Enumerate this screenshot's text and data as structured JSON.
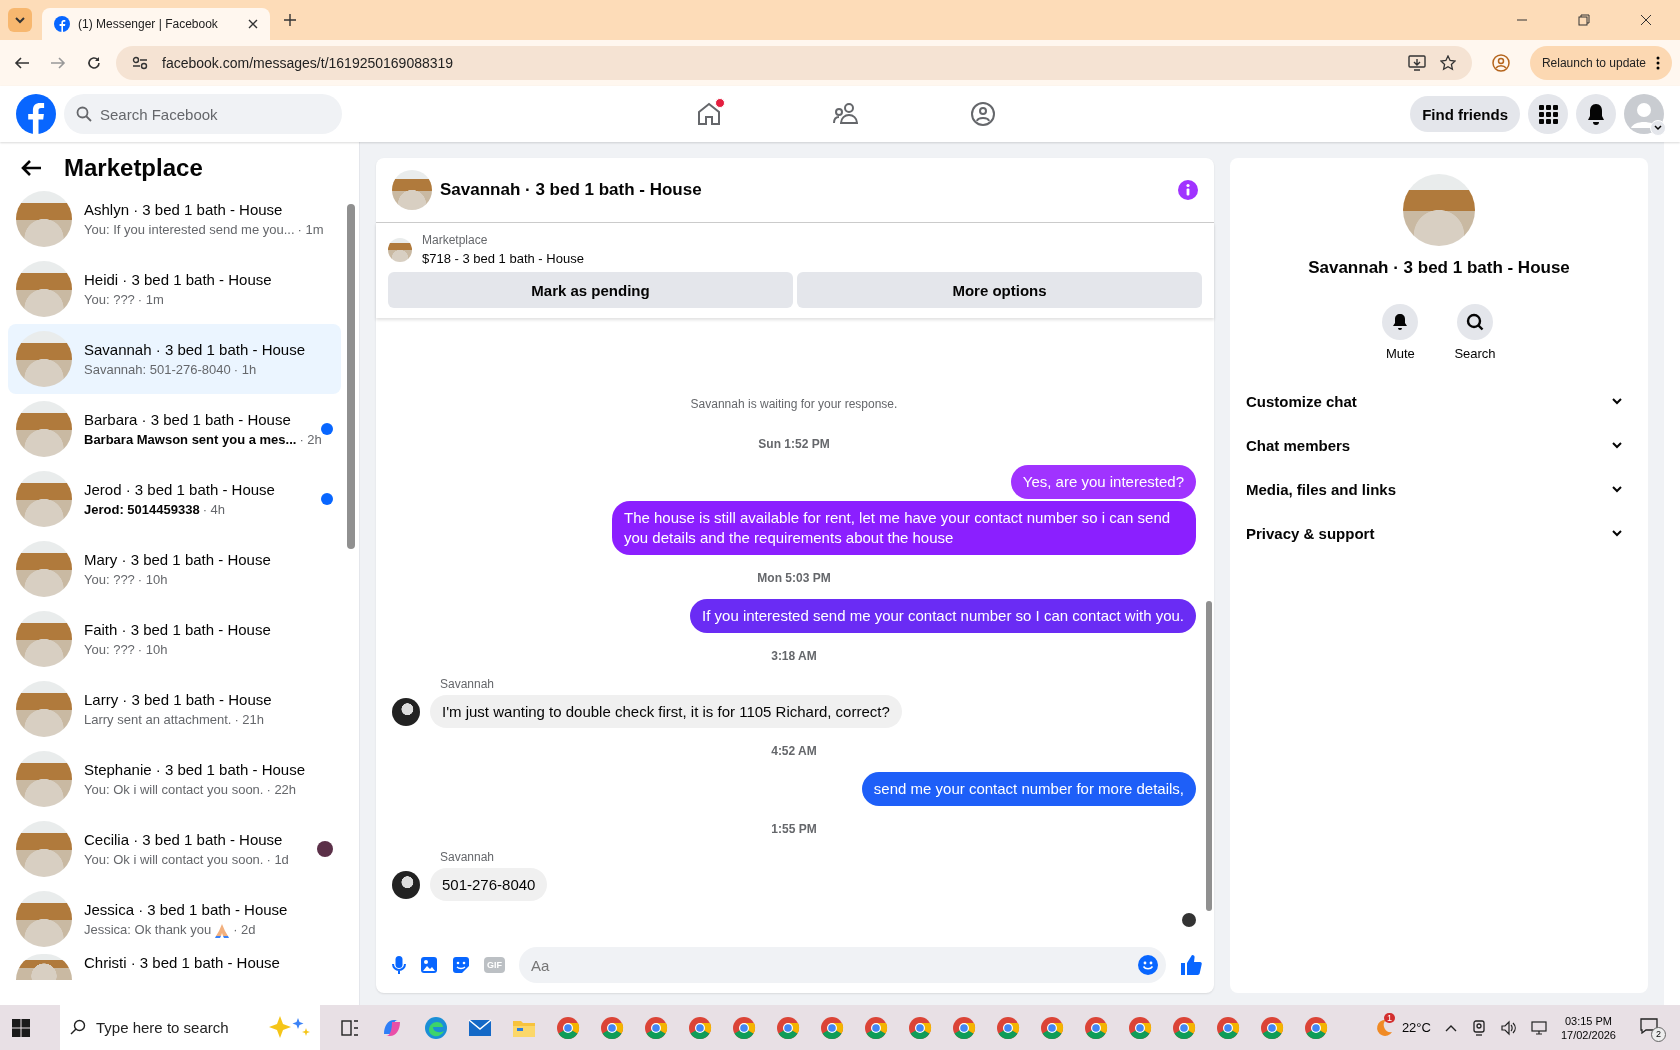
{
  "browser": {
    "tab_title": "(1) Messenger | Facebook",
    "url": "facebook.com/messages/t/1619250169088319",
    "relaunch": "Relaunch to update"
  },
  "header": {
    "search_placeholder": "Search Facebook",
    "nav": [
      {
        "kind": "home",
        "badge": true
      },
      {
        "kind": "friends",
        "badge": false
      },
      {
        "kind": "groups",
        "badge": false
      }
    ],
    "find_friends": "Find friends"
  },
  "sidebar": {
    "title": "Marketplace",
    "conversations": [
      {
        "title": "Ashlyn · 3 bed 1 bath - House",
        "preview": "You: If you interested send me you...",
        "time": "· 1m",
        "selected": false,
        "unread": false,
        "seen": false,
        "emoji": false
      },
      {
        "title": "Heidi · 3 bed 1 bath - House",
        "preview": "You: ???",
        "time": "· 1m",
        "selected": false,
        "unread": false,
        "seen": false,
        "emoji": false
      },
      {
        "title": "Savannah · 3 bed 1 bath - House",
        "preview": "Savannah: 501-276-8040",
        "time": "· 1h",
        "selected": true,
        "unread": false,
        "seen": false,
        "emoji": false
      },
      {
        "title": "Barbara · 3 bed 1 bath - House",
        "preview": "Barbara Mawson sent you a mes...",
        "time": "· 2h",
        "selected": false,
        "unread": true,
        "seen": false,
        "emoji": false
      },
      {
        "title": "Jerod · 3 bed 1 bath - House",
        "preview": "Jerod: 5014459338",
        "time": "· 4h",
        "selected": false,
        "unread": true,
        "seen": false,
        "emoji": false
      },
      {
        "title": "Mary · 3 bed 1 bath - House",
        "preview": "You: ???",
        "time": "· 10h",
        "selected": false,
        "unread": false,
        "seen": false,
        "emoji": false
      },
      {
        "title": "Faith · 3 bed 1 bath - House",
        "preview": "You: ???",
        "time": "· 10h",
        "selected": false,
        "unread": false,
        "seen": false,
        "emoji": false
      },
      {
        "title": "Larry · 3 bed 1 bath - House",
        "preview": "Larry sent an attachment.",
        "time": "· 21h",
        "selected": false,
        "unread": false,
        "seen": false,
        "emoji": false
      },
      {
        "title": "Stephanie · 3 bed 1 bath - House",
        "preview": "You: Ok i will contact you soon.",
        "time": "· 22h",
        "selected": false,
        "unread": false,
        "seen": false,
        "emoji": false
      },
      {
        "title": "Cecilia · 3 bed 1 bath - House",
        "preview": "You: Ok i will contact you soon.",
        "time": "· 1d",
        "selected": false,
        "unread": false,
        "seen": true,
        "emoji": false
      },
      {
        "title": "Jessica · 3 bed 1 bath - House",
        "preview": "Jessica: Ok thank you",
        "time": "· 2d",
        "selected": false,
        "unread": false,
        "seen": false,
        "emoji": true
      },
      {
        "title": "Christi · 3 bed 1 bath - House",
        "selected": false
      }
    ]
  },
  "chat": {
    "title": "Savannah · 3 bed 1 bath - House",
    "listing": {
      "source": "Marketplace",
      "price_title": "$718 - 3 bed 1 bath - House"
    },
    "actions": [
      "Mark as pending",
      "More options"
    ],
    "messages": [
      {
        "kind": "status",
        "text": "Savannah is waiting for your response."
      },
      {
        "kind": "time",
        "text": "Sun 1:52 PM"
      },
      {
        "kind": "sent",
        "text": "Yes, are you interested?",
        "color": "#a033ff"
      },
      {
        "kind": "sent",
        "text": "The house is still available for rent, let me have your contact number so i can send you details and the requirements about the house",
        "color": "#8b1fff"
      },
      {
        "kind": "time",
        "text": "Mon 5:03 PM"
      },
      {
        "kind": "sent",
        "text": "If you interested send me your contact number so I can contact with you.",
        "color": "#6a2cf4"
      },
      {
        "kind": "time",
        "text": "3:18 AM"
      },
      {
        "kind": "received",
        "sender": "Savannah",
        "text": "I'm just wanting to double check first, it is for 1105 Richard, correct?"
      },
      {
        "kind": "time",
        "text": "4:52 AM"
      },
      {
        "kind": "sent",
        "text": "send me your contact number for more details,",
        "color": "#1e5ff8"
      },
      {
        "kind": "time",
        "text": "1:55 PM"
      },
      {
        "kind": "received",
        "sender": "Savannah",
        "text": "501-276-8040"
      }
    ],
    "composer": {
      "placeholder": "Aa",
      "gif": "GIF"
    }
  },
  "details": {
    "title": "Savannah · 3 bed 1 bath - House",
    "actions": [
      {
        "kind": "mute",
        "label": "Mute"
      },
      {
        "kind": "search",
        "label": "Search"
      }
    ],
    "sections": [
      {
        "label": "Customize chat",
        "expanded": false
      },
      {
        "label": "Chat members",
        "expanded": false
      },
      {
        "label": "Media, files and links",
        "expanded": false
      },
      {
        "label": "Privacy & support",
        "expanded": false
      }
    ]
  },
  "taskbar": {
    "search_placeholder": "Type here to search",
    "apps": [
      {
        "kind": "taskview"
      },
      {
        "kind": "copilot"
      },
      {
        "kind": "edge"
      },
      {
        "kind": "mail"
      },
      {
        "kind": "files"
      },
      {
        "kind": "chrome"
      },
      {
        "kind": "chrome"
      },
      {
        "kind": "chrome"
      },
      {
        "kind": "chrome"
      },
      {
        "kind": "chrome"
      },
      {
        "kind": "chrome"
      },
      {
        "kind": "chrome"
      },
      {
        "kind": "chrome"
      },
      {
        "kind": "chrome"
      },
      {
        "kind": "chrome"
      },
      {
        "kind": "chrome"
      },
      {
        "kind": "chrome"
      },
      {
        "kind": "chrome"
      },
      {
        "kind": "chrome"
      },
      {
        "kind": "chrome"
      },
      {
        "kind": "chrome"
      },
      {
        "kind": "chrome"
      },
      {
        "kind": "chrome"
      }
    ],
    "weather_badge": "1",
    "temperature": "22°C",
    "time": "03:15 PM",
    "date": "17/02/2026",
    "notifications": "2"
  }
}
